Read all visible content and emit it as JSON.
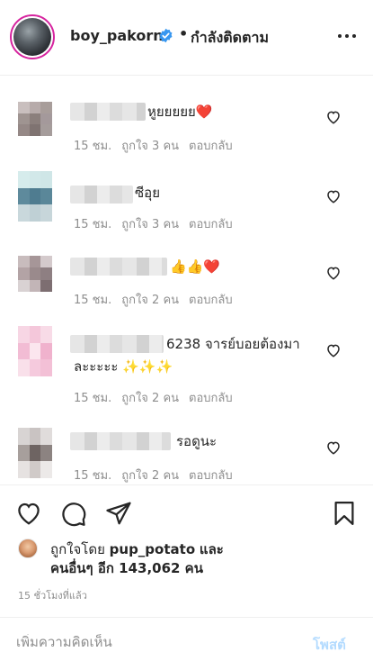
{
  "header": {
    "username": "boy_pakorn",
    "separator": "•",
    "follow_status": "กำลังติดตาม"
  },
  "comments": [
    {
      "text": "หูยยยยย❤️",
      "time": "15 ชม.",
      "likes": "ถูกใจ 3 คน",
      "reply": "ตอบกลับ"
    },
    {
      "text": "ซีอุย",
      "time": "15 ชม.",
      "likes": "ถูกใจ 3 คน",
      "reply": "ตอบกลับ"
    },
    {
      "text": "👍👍❤️",
      "time": "15 ชม.",
      "likes": "ถูกใจ 2 คน",
      "reply": "ตอบกลับ"
    },
    {
      "text": "6238 จารย์บอยต้องมา",
      "text_line2": "ละะะะะ ✨✨✨",
      "time": "15 ชม.",
      "likes": "ถูกใจ 2 คน",
      "reply": "ตอบกลับ"
    },
    {
      "text": "รอดูนะ",
      "time": "15 ชม.",
      "likes": "ถูกใจ 2 คน",
      "reply": "ตอบกลับ"
    }
  ],
  "likes": {
    "prefix": "ถูกใจโดย",
    "liker": "pup_potato",
    "and": "และ",
    "others": "คนอื่นๆ อีก 143,062 คน"
  },
  "timestamp": "15 ชั่วโมงที่แล้ว",
  "add_comment": {
    "placeholder": "เพิ่มความคิดเห็น",
    "post_label": "โพสต์"
  },
  "icons": {
    "verified": "verified-badge-icon",
    "more": "more-options-icon",
    "heart": "heart-icon",
    "comment": "comment-icon",
    "share": "share-icon",
    "save": "bookmark-icon"
  },
  "colors": {
    "verified": "#3897f0",
    "text": "#262626",
    "muted": "#8e8e8e",
    "post_disabled": "#b3dbff",
    "story_ring": "#d6249f"
  }
}
